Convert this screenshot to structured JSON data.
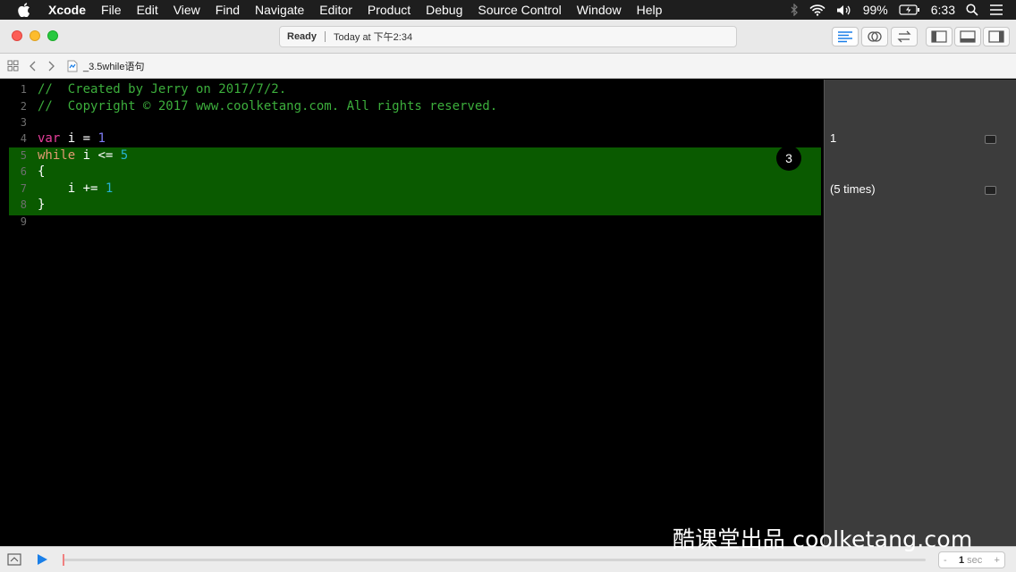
{
  "menubar": {
    "app_name": "Xcode",
    "items": [
      "File",
      "Edit",
      "View",
      "Find",
      "Navigate",
      "Editor",
      "Product",
      "Debug",
      "Source Control",
      "Window",
      "Help"
    ],
    "battery": "99%",
    "time": "6:33"
  },
  "toolbar": {
    "status": "Ready",
    "timestamp": "Today at 下午2:34"
  },
  "jumpbar": {
    "file_name": "_3.5while语句"
  },
  "editor": {
    "line_numbers": [
      "1",
      "2",
      "3",
      "4",
      "5",
      "6",
      "7",
      "8",
      "9"
    ],
    "line1": "//  Created by Jerry on 2017/7/2.",
    "line2": "//  Copyright © 2017 www.coolketang.com. All rights reserved.",
    "line4_kw": "var",
    "line4_rest": " i = ",
    "line4_num": "1",
    "line5_kw": "while",
    "line5_rest": " i <= ",
    "line5_num": "5",
    "line6": "{",
    "line7_rest": "    i += ",
    "line7_num": "1",
    "line8": "}",
    "iteration_badge": "3"
  },
  "results": {
    "line4_result": "1",
    "line7_result": "(5 times)"
  },
  "debugbar": {
    "minus": "-",
    "duration": "1",
    "unit": "sec",
    "plus": "+"
  },
  "watermark": "酷课堂出品 coolketang.com",
  "colors": {
    "highlight": "#0a5a00",
    "comment": "#3cae3c",
    "keyword": "#e83f9c"
  }
}
